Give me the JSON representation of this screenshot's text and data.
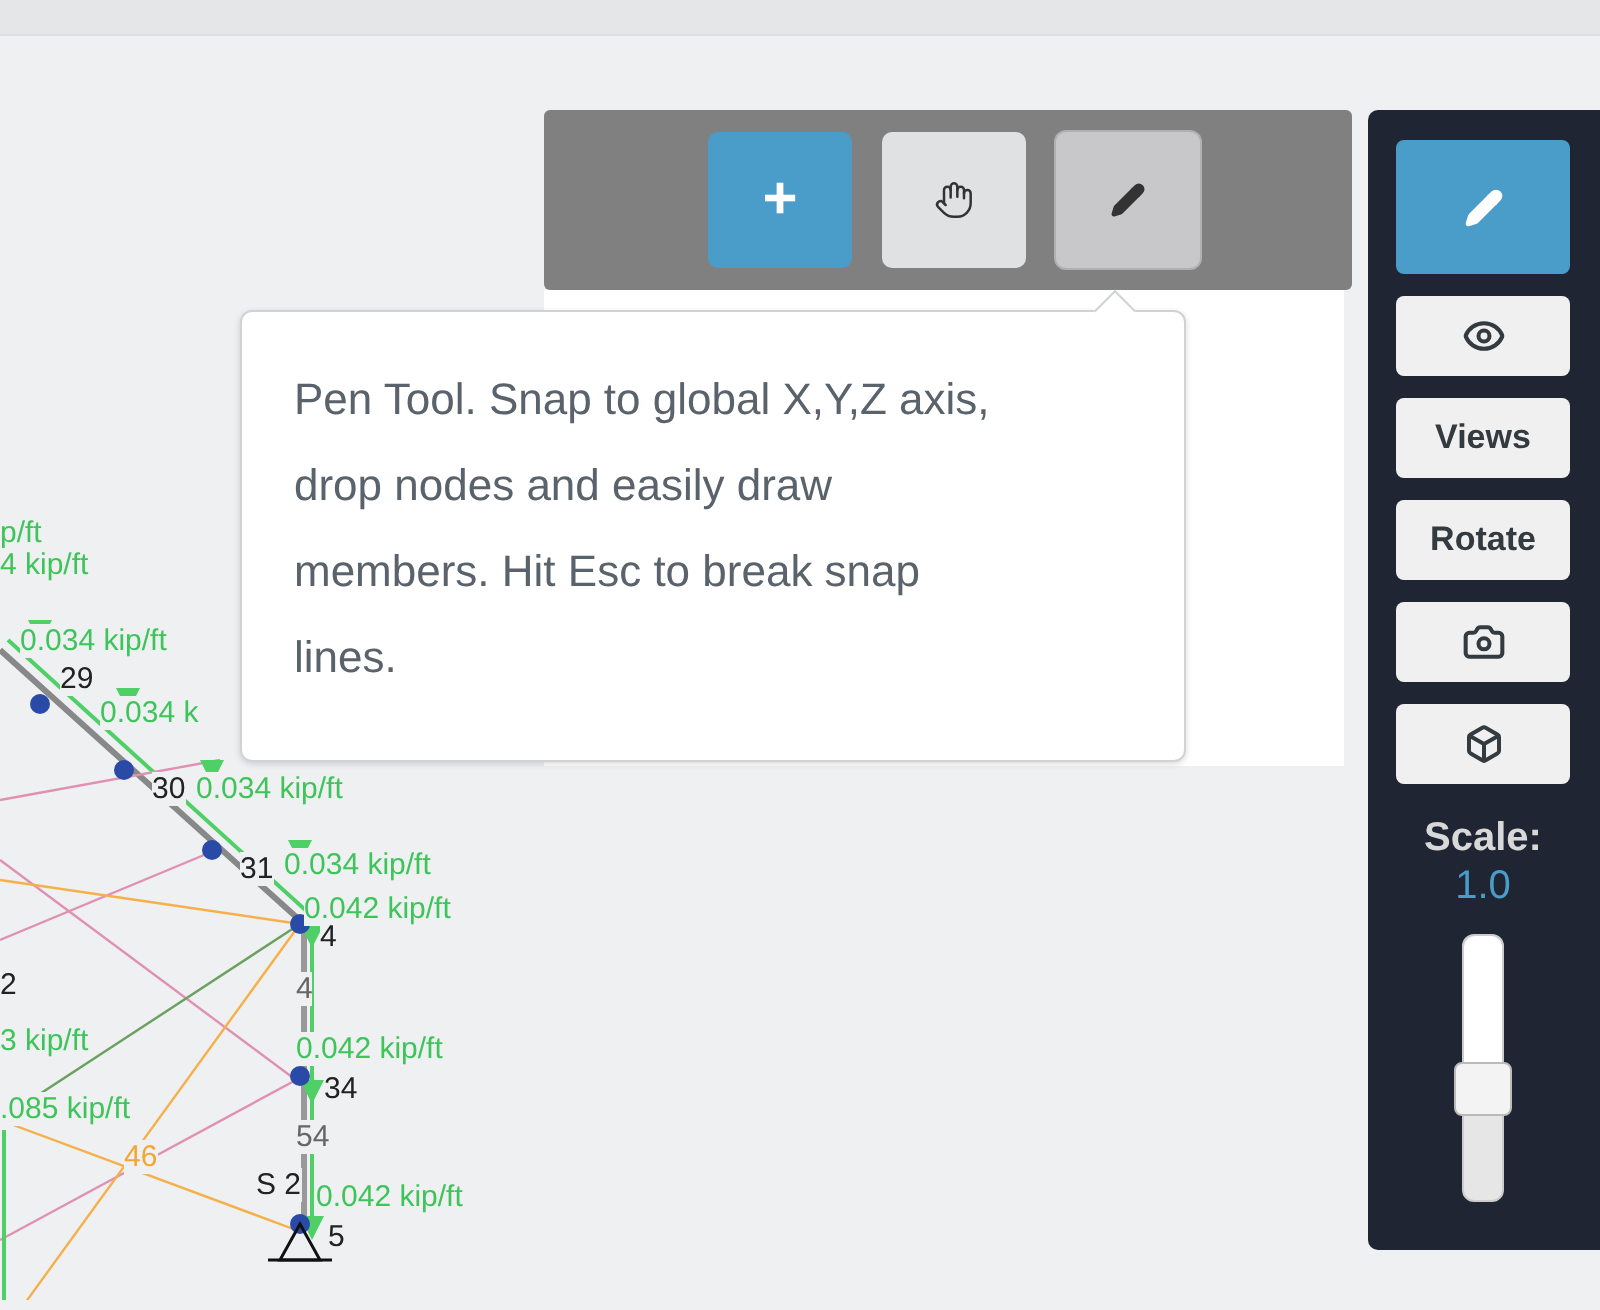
{
  "toolbar": {
    "buttons": [
      {
        "kind": "add",
        "label": "+",
        "selected": false
      },
      {
        "kind": "pan",
        "selected": false
      },
      {
        "kind": "pen",
        "selected": true
      }
    ]
  },
  "tooltip": {
    "text": "Pen Tool. Snap to global X,Y,Z axis, drop nodes and easily draw members. Hit Esc to break snap lines."
  },
  "side_panel": {
    "buttons": [
      {
        "kind": "pen",
        "selected": true
      },
      {
        "kind": "eye",
        "selected": false
      },
      {
        "kind": "text",
        "label": "Views",
        "selected": false
      },
      {
        "kind": "text",
        "label": "Rotate",
        "selected": false
      },
      {
        "kind": "camera",
        "selected": false
      },
      {
        "kind": "cube",
        "selected": false
      }
    ],
    "scale": {
      "label": "Scale:",
      "value": "1.0",
      "level": 0.42
    }
  },
  "canvas": {
    "labels": [
      {
        "kind": "load",
        "text": "p/ft"
      },
      {
        "kind": "load",
        "text": "4 kip/ft"
      },
      {
        "kind": "load",
        "text": "0.034 kip/ft"
      },
      {
        "kind": "node",
        "text": "29"
      },
      {
        "kind": "load",
        "text": "0.034 k"
      },
      {
        "kind": "node",
        "text": "30"
      },
      {
        "kind": "load",
        "text": "0.034 kip/ft"
      },
      {
        "kind": "node",
        "text": "31"
      },
      {
        "kind": "load",
        "text": "0.034 kip/ft"
      },
      {
        "kind": "load",
        "text": "0.042 kip/ft"
      },
      {
        "kind": "node",
        "text": "4"
      },
      {
        "kind": "member",
        "text": "4"
      },
      {
        "kind": "node",
        "text": "2"
      },
      {
        "kind": "load",
        "text": "3 kip/ft"
      },
      {
        "kind": "load",
        "text": "0.042 kip/ft"
      },
      {
        "kind": "node",
        "text": "34"
      },
      {
        "kind": "load",
        "text": ".085 kip/ft"
      },
      {
        "kind": "member",
        "text": "54"
      },
      {
        "kind": "plate",
        "text": "46"
      },
      {
        "kind": "node",
        "text": "S 2"
      },
      {
        "kind": "load",
        "text": "0.042 kip/ft"
      },
      {
        "kind": "node",
        "text": "5"
      }
    ]
  }
}
